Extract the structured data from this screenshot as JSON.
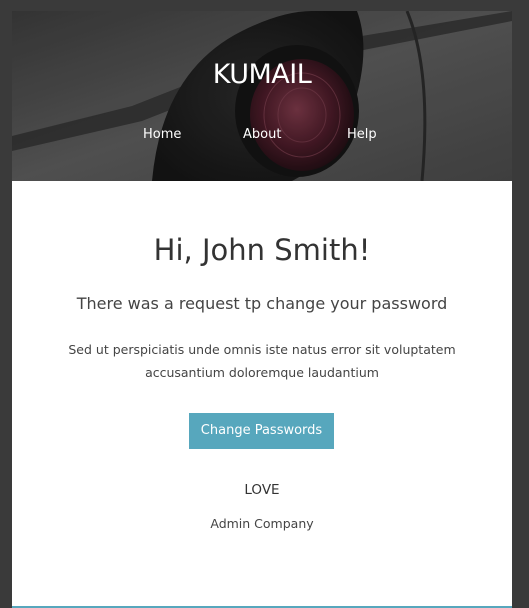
{
  "header": {
    "brand": "KUMAIL",
    "nav": [
      "Home",
      "About",
      "Help"
    ]
  },
  "email": {
    "greeting": "Hi, John Smith!",
    "subtitle": "There was a request tp change your password",
    "body_line_1": "Sed ut perspiciatis unde omnis iste natus error sit voluptatem",
    "body_line_2": "accusantium doloremque laudantium",
    "cta_label": "Change Passwords",
    "signoff": "LOVE",
    "company": "Admin Company"
  },
  "colors": {
    "accent": "#57a7bd",
    "text": "#333333",
    "page_bg": "#3a3a3a"
  }
}
